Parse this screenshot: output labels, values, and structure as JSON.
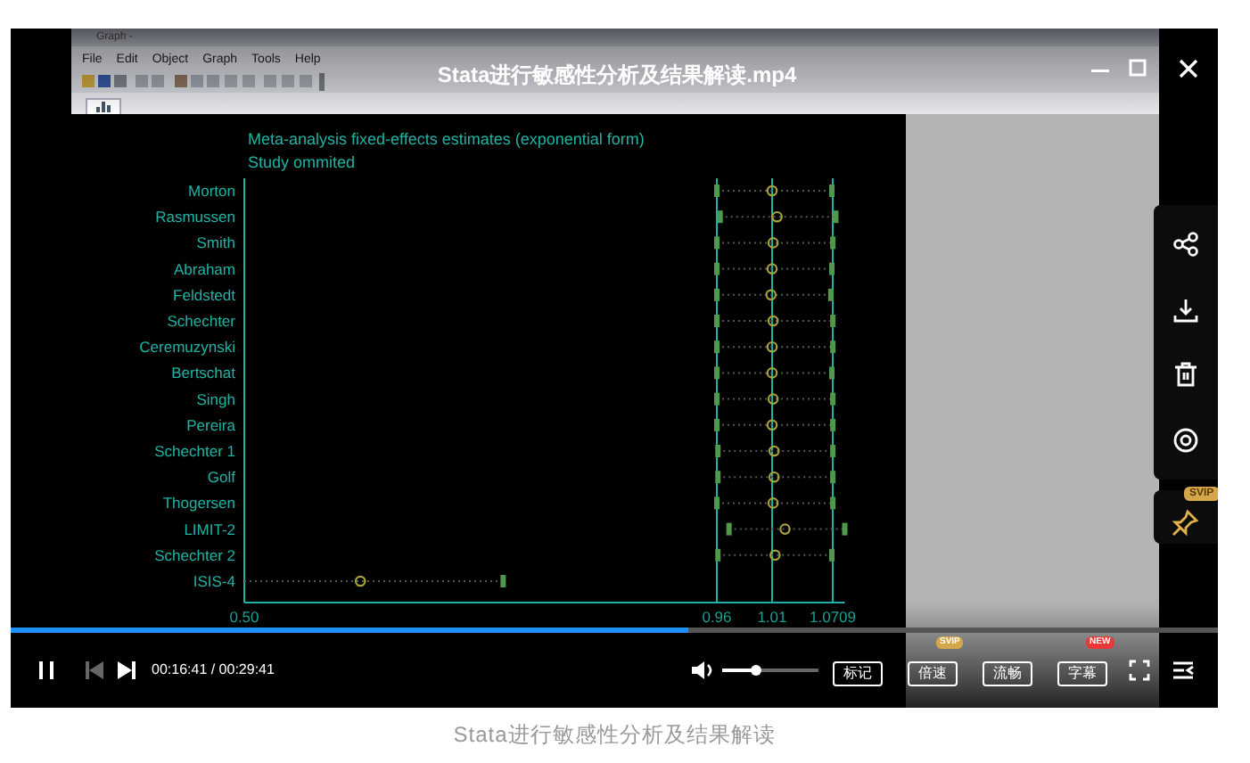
{
  "player": {
    "title": "Stata进行敏感性分析及结果解读.mp4",
    "playing": true,
    "prev_disabled": true,
    "time": "00:16:41 / 00:29:41",
    "progress": {
      "level": 0.562
    },
    "volume": {
      "level": 0.35
    },
    "buttons": [
      {
        "label": "标记"
      },
      {
        "label": "倍速",
        "badge": {
          "text": "SVIP",
          "color": "#d6a64a"
        }
      },
      {
        "label": "流畅"
      },
      {
        "label": "字幕",
        "badge": {
          "text": "NEW",
          "color": "#e5393a"
        }
      }
    ],
    "pin_badge": {
      "text": "SVIP",
      "color": "#d6a64a"
    }
  },
  "app_window": {
    "title": "Graph -",
    "menu": [
      "File",
      "Edit",
      "Object",
      "Graph",
      "Tools",
      "Help"
    ],
    "graph": {
      "title": "Meta-analysis fixed-effects estimates (exponential form)",
      "subtitle": "Study ommited",
      "chart_data": {
        "type": "scatter",
        "orientation": "horizontal",
        "xlim": [
          0.5,
          1.083
        ],
        "categories": [
          "Morton",
          "Rasmussen",
          "Smith",
          "Abraham",
          "Feldstedt",
          "Schechter",
          "Ceremuzynski",
          "Bertschat",
          "Singh",
          "Pereira",
          "Schechter 1",
          "Golf",
          "Thogersen",
          "LIMIT-2",
          "Schechter 2",
          "ISIS-4"
        ],
        "series": [
          {
            "color": "#a9a33e",
            "values": [
              1.01,
              1.015,
              1.011,
              1.01,
              1.009,
              1.011,
              1.01,
              1.01,
              1.011,
              1.01,
              1.012,
              1.012,
              1.011,
              1.023,
              1.013,
              0.613
            ]
          },
          {
            "color": "#4e9a4a",
            "values": [
              0.96,
              0.963,
              0.96,
              0.96,
              0.96,
              0.96,
              0.96,
              0.96,
              0.96,
              0.96,
              0.961,
              0.961,
              0.96,
              0.971,
              0.961,
              null
            ]
          },
          {
            "color": "#4e9a4a",
            "values": [
              1.07,
              1.074,
              1.071,
              1.07,
              1.069,
              1.071,
              1.071,
              1.07,
              1.071,
              1.071,
              1.071,
              1.071,
              1.071,
              1.083,
              1.07,
              0.752
            ]
          }
        ],
        "xticks": [
          {
            "value": 0.5,
            "label": "0.50"
          },
          {
            "value": 0.96,
            "label": "0.96"
          },
          {
            "value": 1.01,
            "label": "1.01"
          },
          {
            "value": 1.0709,
            "label": "1.0709"
          }
        ],
        "ref_lines": [
          {
            "axis": "x",
            "value": 0.96
          },
          {
            "axis": "x",
            "value": 1.01
          },
          {
            "axis": "x",
            "value": 1.0709
          }
        ]
      }
    }
  },
  "caption": "Stata进行敏感性分析及结果解读"
}
